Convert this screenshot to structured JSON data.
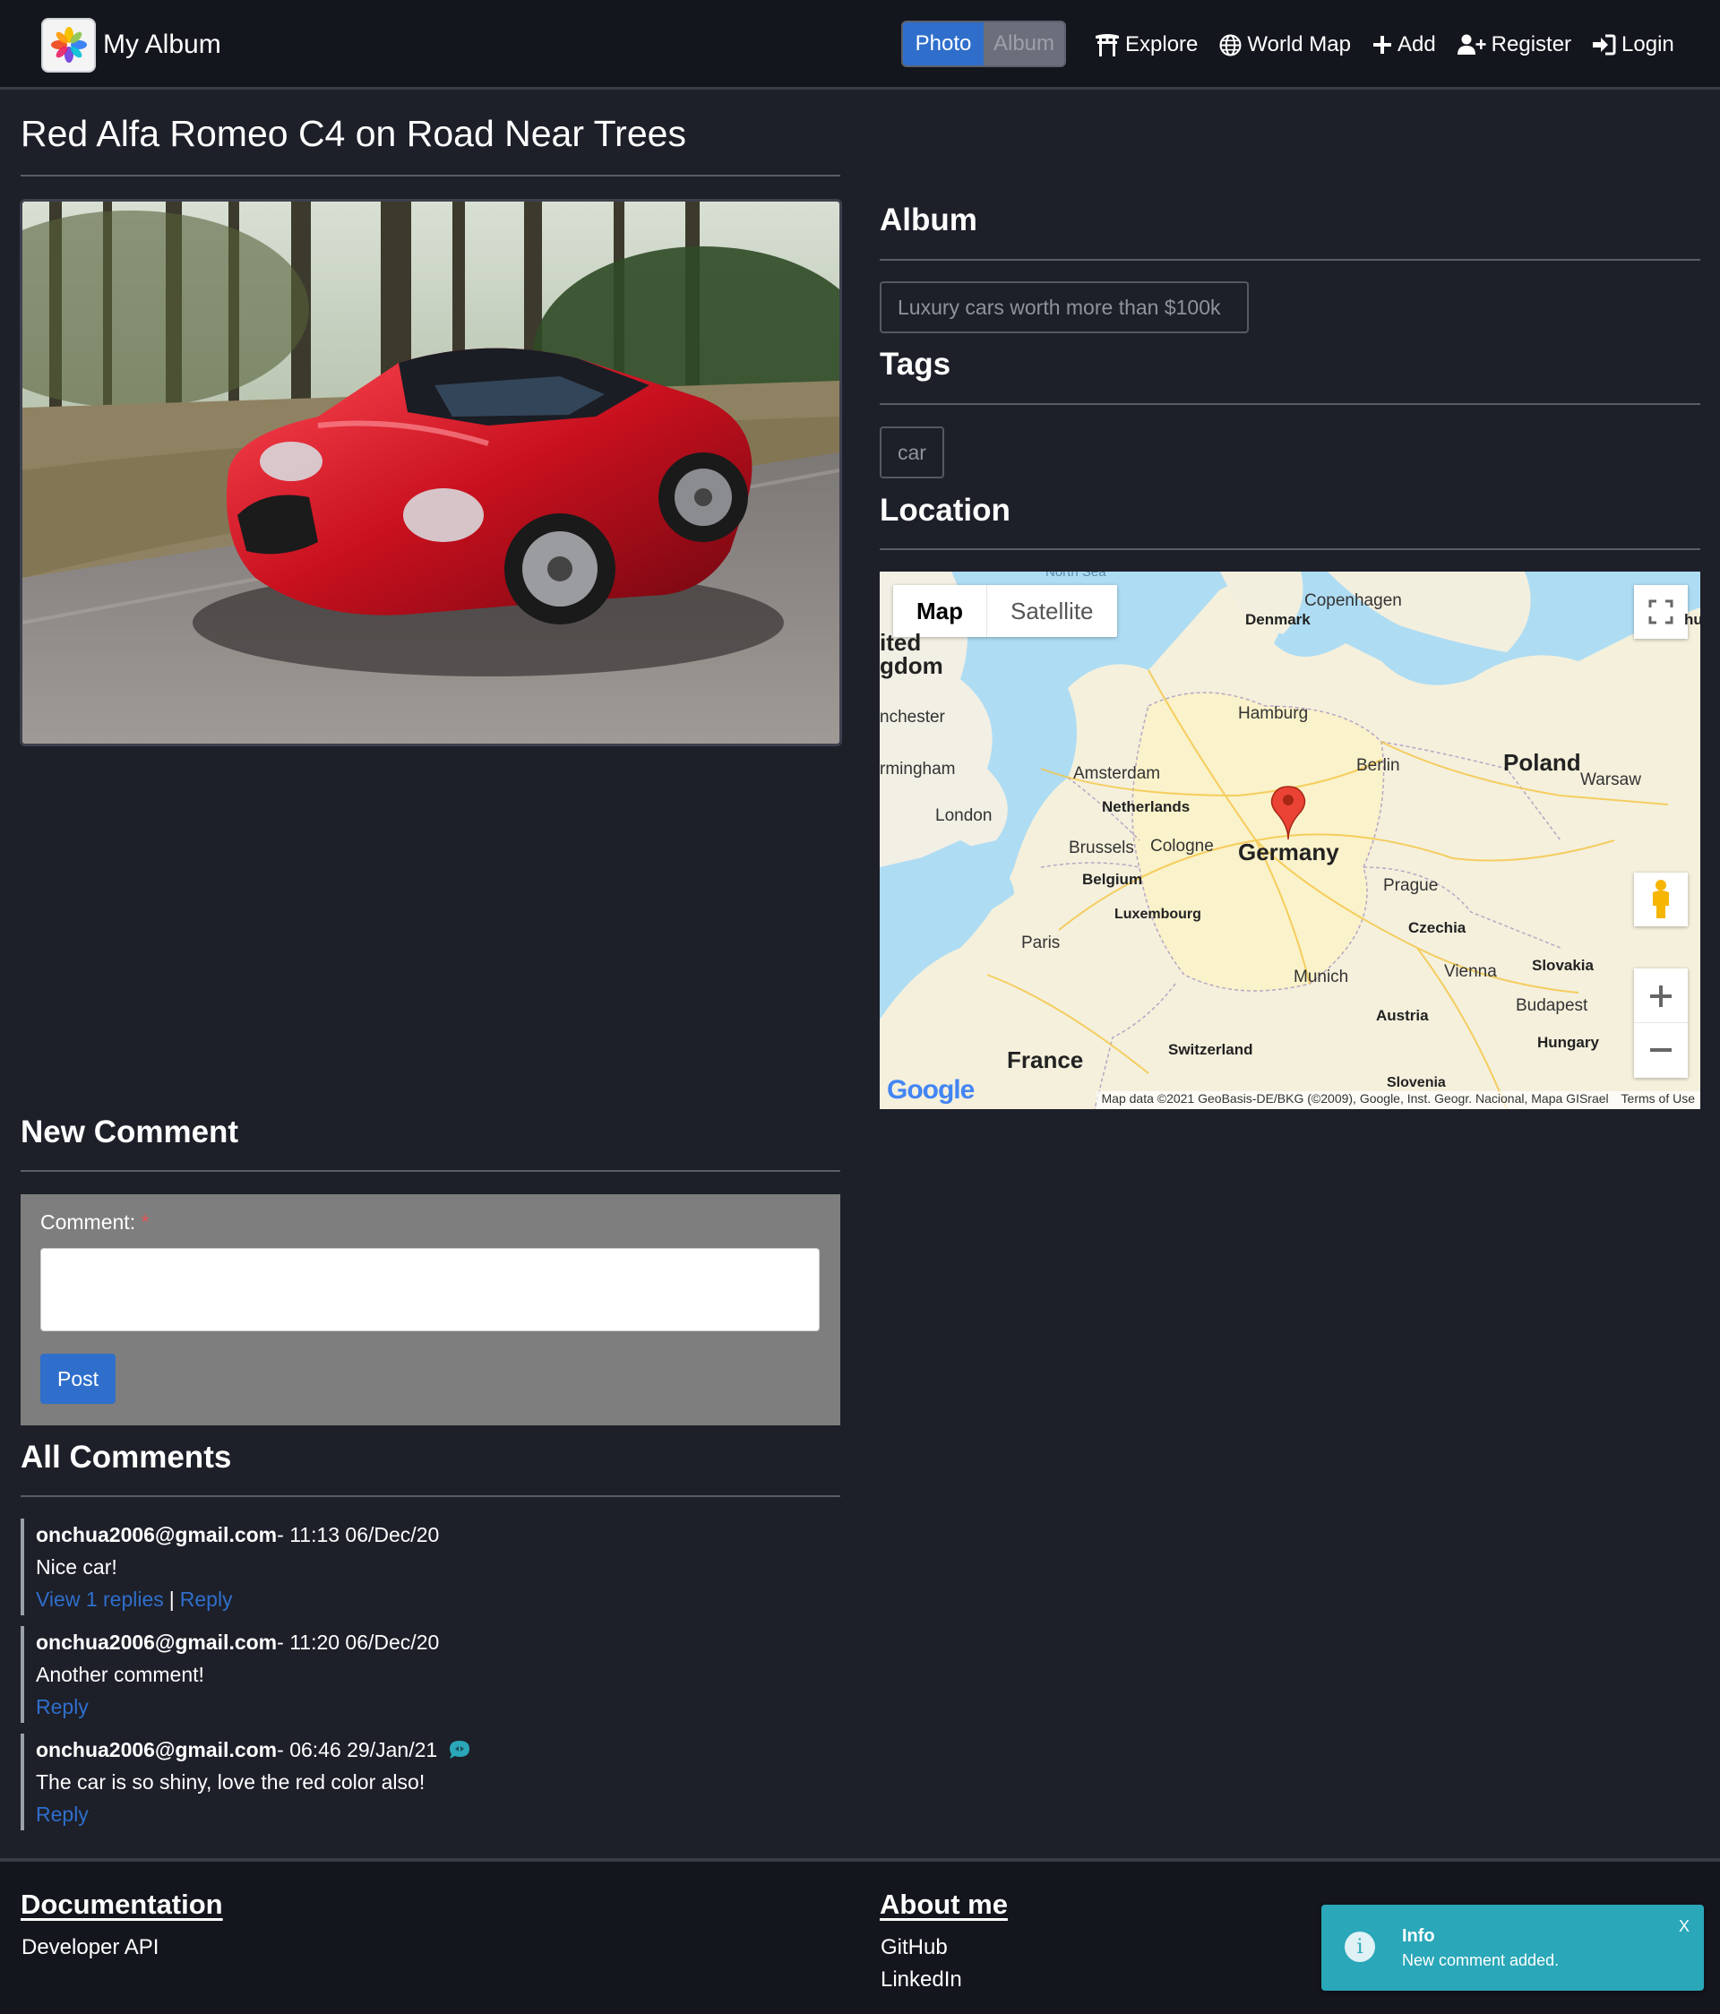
{
  "navbar": {
    "brand": "My Album",
    "toggle": {
      "photo": "Photo",
      "album": "Album"
    },
    "links": {
      "explore": "Explore",
      "world_map": "World Map",
      "add": "Add",
      "register": "Register",
      "login": "Login"
    }
  },
  "page": {
    "title": "Red Alfa Romeo C4 on Road Near Trees"
  },
  "album": {
    "heading": "Album",
    "value": "Luxury cars worth more than $100k"
  },
  "tags": {
    "heading": "Tags",
    "items": [
      "car"
    ]
  },
  "location": {
    "heading": "Location",
    "map": {
      "type_map": "Map",
      "type_satellite": "Satellite",
      "labels": {
        "north_sea": "North Sea",
        "copenhagen": "Copenhagen",
        "denmark": "Denmark",
        "united": "ited",
        "kingdom": "gdom",
        "manchester": "nchester",
        "hamburg": "Hamburg",
        "birmingham": "rmingham",
        "amsterdam": "Amsterdam",
        "berlin": "Berlin",
        "poland": "Poland",
        "warsaw": "Warsaw",
        "london": "London",
        "netherlands": "Netherlands",
        "brussels": "Brussels",
        "cologne": "Cologne",
        "germany": "Germany",
        "belgium": "Belgium",
        "prague": "Prague",
        "luxembourg": "Luxembourg",
        "czechia": "Czechia",
        "paris": "Paris",
        "slovakia": "Slovakia",
        "munich": "Munich",
        "vienna": "Vienna",
        "budapest": "Budapest",
        "austria": "Austria",
        "france": "France",
        "switzerland": "Switzerland",
        "hungary": "Hungary",
        "slovenia": "Slovenia",
        "edge_hu": "hu"
      },
      "attribution": "Map data ©2021 GeoBasis-DE/BKG (©2009), Google, Inst. Geogr. Nacional, Mapa GISrael",
      "terms": "Terms of Use",
      "logo": "Google"
    }
  },
  "new_comment": {
    "heading": "New Comment",
    "label": "Comment:",
    "required_mark": "*",
    "textarea_value": "",
    "post_label": "Post"
  },
  "all_comments": {
    "heading": "All Comments",
    "items": [
      {
        "author": "onchua2006@gmail.com",
        "time": " - 11:13 06/Dec/20",
        "body": "Nice car!",
        "view_replies": "View 1 replies",
        "separator": "|",
        "reply": "Reply"
      },
      {
        "author": "onchua2006@gmail.com",
        "time": " - 11:20 06/Dec/20",
        "body": "Another comment!",
        "reply": "Reply"
      },
      {
        "author": "onchua2006@gmail.com",
        "time": " - 06:46 29/Jan/21",
        "body": "The car is so shiny, love the red color also!",
        "reply": "Reply"
      }
    ]
  },
  "footer": {
    "documentation": {
      "heading": "Documentation",
      "links": [
        "Developer API"
      ]
    },
    "about": {
      "heading": "About me",
      "links": [
        "GitHub",
        "LinkedIn"
      ]
    }
  },
  "toast": {
    "title": "Info",
    "message": "New comment added.",
    "close": "X",
    "icon": "i"
  },
  "colors": {
    "background": "#1d1f29",
    "navbar": "#14161d",
    "accent": "#2f6fcb",
    "toast": "#2aa7b8",
    "form": "#7e7e7e"
  }
}
